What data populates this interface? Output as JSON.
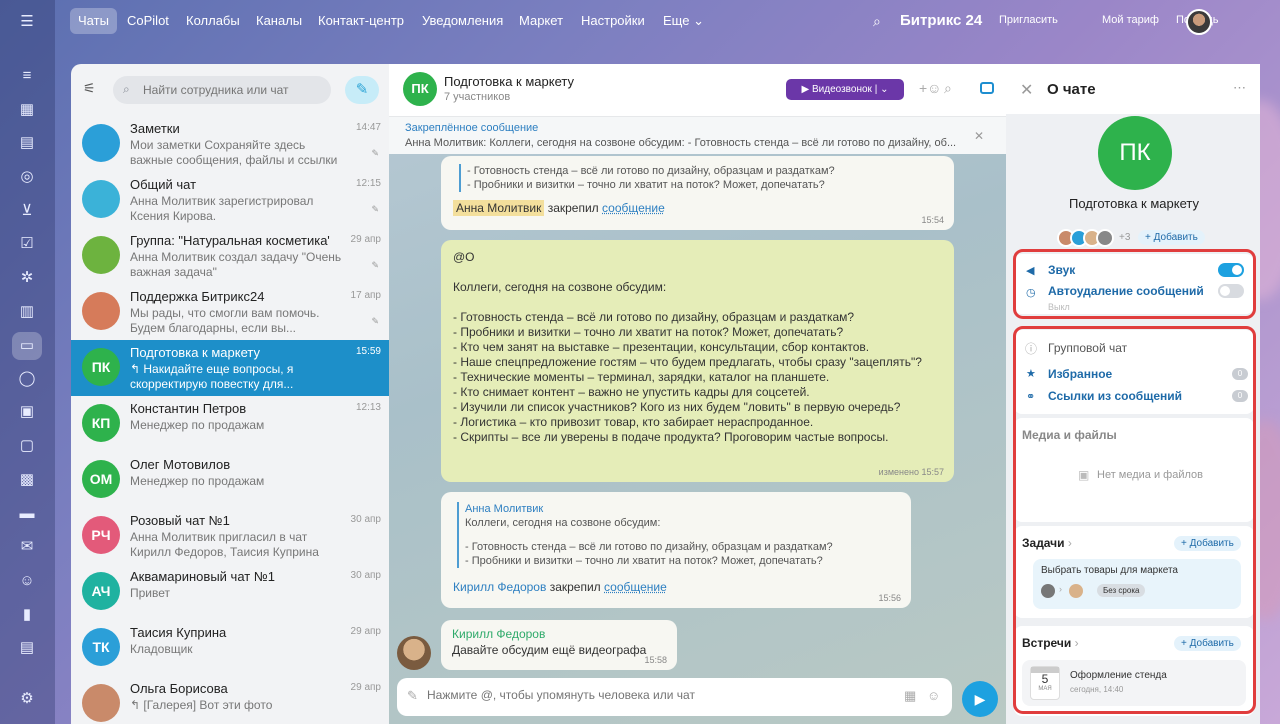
{
  "nav": {
    "items": [
      "Чаты",
      "CoPilot",
      "Коллабы",
      "Каналы",
      "Контакт-центр",
      "Уведомления",
      "Маркет",
      "Настройки",
      "Еще"
    ],
    "brand": "Битрикс 24",
    "invite": "Пригласить",
    "tariff": "Мой тариф",
    "help": "Помощь"
  },
  "search": {
    "placeholder": "Найти сотрудника или чат"
  },
  "chats": [
    {
      "name": "Заметки",
      "preview": "Мои заметки Сохраняйте здесь важные сообщения, файлы и ссылки",
      "time": "14:47",
      "avatar": "",
      "color": "#2b9fd8"
    },
    {
      "name": "Общий чат",
      "preview": "Анна Молитвик зарегистрировал Ксения Кирова.",
      "time": "12:15",
      "avatar": "",
      "color": "#3bb2d8"
    },
    {
      "name": "Группа: \"Натуральная косметика\"",
      "preview": "Анна Молитвик создал задачу \"Очень важная задача\"",
      "time": "29 апр",
      "avatar": "",
      "color": "#6db33f"
    },
    {
      "name": "Поддержка Битрикс24",
      "preview": "Мы рады, что смогли вам помочь. Будем благодарны, если вы...",
      "time": "17 апр",
      "avatar": "",
      "color": "#d67b5a"
    },
    {
      "name": "Подготовка к маркету",
      "preview": "↰ Накидайте еще вопросы, я скорректирую повестку для...",
      "time": "15:59",
      "avatar": "ПК",
      "color": "#2eb24c"
    },
    {
      "name": "Константин Петров",
      "preview": "Менеджер по продажам",
      "time": "12:13",
      "avatar": "КП",
      "color": "#2eb24c"
    },
    {
      "name": "Олег Мотовилов",
      "preview": "Менеджер по продажам",
      "time": "",
      "avatar": "ОМ",
      "color": "#2eb24c"
    },
    {
      "name": "Розовый чат №1",
      "preview": "Анна Молитвик пригласил в чат Кирилл Федоров, Таисия Куприна",
      "time": "30 апр",
      "avatar": "РЧ",
      "color": "#e35a7a"
    },
    {
      "name": "Аквамариновый чат №1",
      "preview": "Привет",
      "time": "30 апр",
      "avatar": "АЧ",
      "color": "#1fb2a0"
    },
    {
      "name": "Таисия Куприна",
      "preview": "Кладовщик",
      "time": "29 апр",
      "avatar": "ТК",
      "color": "#2b9fd8"
    },
    {
      "name": "Ольга Борисова",
      "preview": "↰ [Галерея] Вот эти фото",
      "time": "29 апр",
      "avatar": "",
      "color": "#c98a6a"
    }
  ],
  "chat": {
    "title": "Подготовка к маркету",
    "subtitle": "7 участников",
    "avatar": "ПК",
    "video_label": "Видеозвонок",
    "pinned_label": "Закреплённое сообщение",
    "pinned_text": "Анна Молитвик: Коллеги, сегодня на созвоне обсудим: - Готовность стенда – всё ли готово по дизайну, об...",
    "m1": {
      "q1": "- Готовность стенда – всё ли готово по дизайну, образцам и раздаткам?",
      "q2": "- Пробники и визитки – точно ли хватит на поток? Может, допечатать?",
      "who": "Анна Молитвик",
      "action": "закрепил",
      "link": "сообщение",
      "time": "15:54"
    },
    "m2": {
      "lines": [
        "@О",
        "",
        "Коллеги, сегодня на созвоне обсудим:",
        "",
        "- Готовность стенда – всё ли готово по дизайну, образцам и раздаткам?",
        "- Пробники и визитки – точно ли хватит на поток? Может, допечатать?",
        "- Кто чем занят на выставке – презентации, консультации, сбор контактов.",
        "- Наше спецпредложение гостям – что будем предлагать, чтобы сразу \"зацеплять\"?",
        "- Технические моменты – терминал, зарядки, каталог на планшете.",
        "- Кто снимает контент – важно не упустить кадры для соцсетей.",
        "- Изучили ли список участников? Кого из них будем \"ловить\" в первую очередь?",
        "- Логистика – кто привозит товар, кто забирает нераспроданное.",
        "- Скрипты – все ли уверены в подаче продукта? Проговорим частые вопросы."
      ],
      "time": "изменено 15:57"
    },
    "m3": {
      "qname": "Анна Молитвик",
      "q0": "Коллеги, сегодня на созвоне обсудим:",
      "q1": "- Готовность стенда – всё ли готово по дизайну, образцам и раздаткам?",
      "q2": "- Пробники и визитки – точно ли хватит на поток? Может, допечатать?",
      "who": "Кирилл Федоров",
      "action": "закрепил",
      "link": "сообщение",
      "time": "15:56"
    },
    "m4": {
      "name": "Кирилл Федоров",
      "text": "Давайте обсудим ещё видеографа",
      "time": "15:58"
    },
    "composer_placeholder": "Нажмите @, чтобы упомянуть человека или чат"
  },
  "panel": {
    "title": "О чате",
    "avatar": "ПК",
    "name": "Подготовка к маркету",
    "members_more": "+3",
    "add": "Добавить",
    "sound": "Звук",
    "autodelete": "Автоудаление сообщений",
    "autodelete_state": "Выкл",
    "group_chat": "Групповой чат",
    "favorites": "Избранное",
    "favorites_count": "0",
    "links": "Ссылки из сообщений",
    "links_count": "0",
    "media_title": "Медиа и файлы",
    "media_empty": "Нет медиа и файлов",
    "tasks_title": "Задачи",
    "task_name": "Выбрать товары для маркета",
    "task_deadline": "Без срока",
    "meetings_title": "Встречи",
    "meeting_day": "5",
    "meeting_month": "МАЯ",
    "meeting_name": "Оформление стенда",
    "meeting_time": "сегодня, 14:40"
  }
}
